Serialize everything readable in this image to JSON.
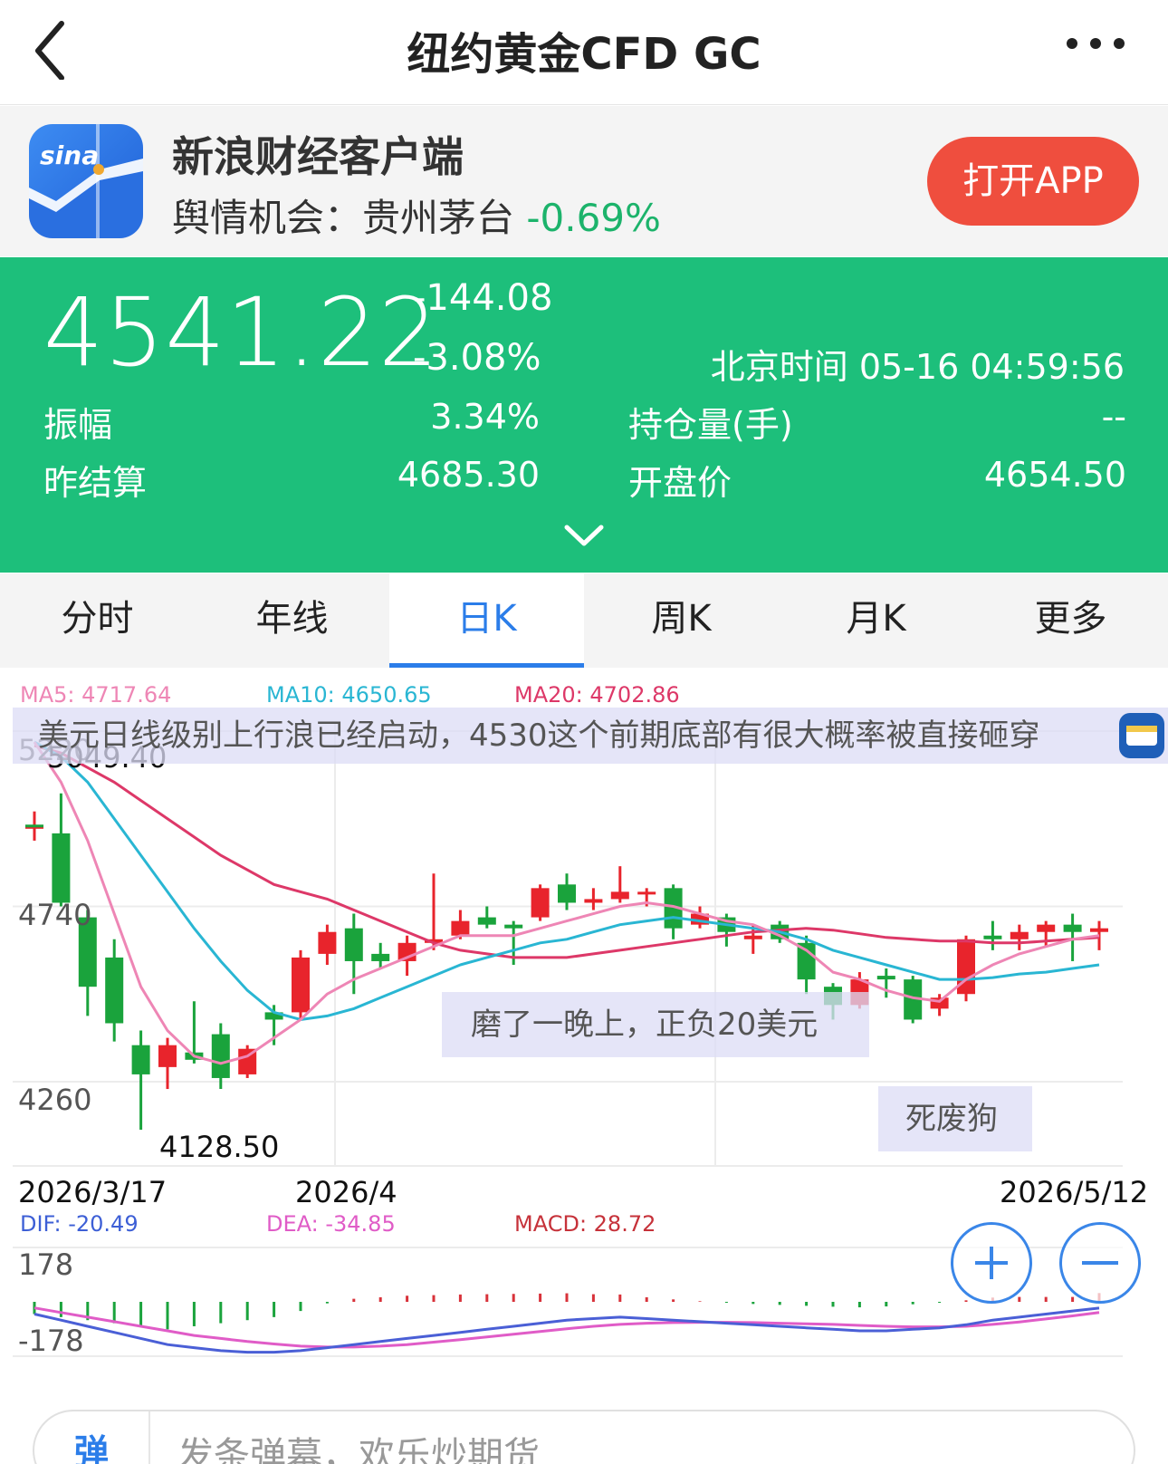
{
  "nav": {
    "title": "纽约黄金CFD GC"
  },
  "banner": {
    "app_name": "新浪财经客户端",
    "sub_prefix": "舆情机会：贵州茅台 ",
    "sub_pct": "-0.69%",
    "open_button": "打开APP",
    "logo_text": "sina",
    "color_button": "#ef4e3e"
  },
  "quote": {
    "price": "4541.22",
    "change": "-144.08",
    "change_pct": "-3.08%",
    "time": "北京时间 05-16 04:59:56",
    "amplitude_label": "振幅",
    "amplitude_value": "3.34%",
    "open_interest_label": "持仓量(手)",
    "open_interest_value": "--",
    "prev_settle_label": "昨结算",
    "prev_settle_value": "4685.30",
    "open_label": "开盘价",
    "open_value": "4654.50",
    "color_panel": "#1dbf7b"
  },
  "tabs": [
    {
      "label": "分时",
      "active": false
    },
    {
      "label": "年线",
      "active": false
    },
    {
      "label": "日K",
      "active": true
    },
    {
      "label": "周K",
      "active": false
    },
    {
      "label": "月K",
      "active": false
    },
    {
      "label": "更多",
      "active": false
    }
  ],
  "chart": {
    "ma5": "MA5: 4717.64",
    "ma10": "MA10: 4650.65",
    "ma20": "MA20: 4702.86",
    "y_top": "5220",
    "y_mid": "4740",
    "y_bottom": "4260",
    "high_label": "5049.40",
    "low_label": "4128.50",
    "date_start": "2026/3/17",
    "date_mid": "2026/4",
    "date_end": "2026/5/12",
    "dif": "DIF: -20.49",
    "dea": "DEA: -34.85",
    "macd": "MACD: 28.72",
    "macd_top": "178",
    "macd_bottom": "-178"
  },
  "danmaku": {
    "d1": "美元日线级别上行浪已经启动，4530这个前期底部有很大概率被直接砸穿",
    "d2": "磨了一晚上，正负20美元",
    "d3": "死废狗"
  },
  "comment": {
    "icon": "弹",
    "placeholder": "发条弹幕，欢乐炒期货"
  },
  "chart_data": {
    "type": "candlestick",
    "title": "",
    "x": [
      "2026/3/17",
      "",
      "",
      "",
      "",
      "",
      "",
      "",
      "",
      "",
      "",
      "2026/4",
      "",
      "",
      "",
      "",
      "",
      "",
      "",
      "",
      "",
      "",
      "",
      "",
      "",
      "",
      "",
      "",
      "",
      "",
      "",
      "",
      "",
      "",
      "",
      "",
      "",
      "",
      "",
      "",
      "2026/5/12"
    ],
    "ylim": [
      4128.5,
      5220
    ],
    "y_ticks": [
      5220,
      4740,
      4260
    ],
    "colors": {
      "up": "#e8242c",
      "down": "#1aa33c",
      "ma5": "#ee86b5",
      "ma10": "#29b6d3",
      "ma20": "#dd3868"
    },
    "candles": [
      {
        "o": 4960,
        "c": 4960,
        "h": 5000,
        "l": 4920
      },
      {
        "o": 4940,
        "c": 4750,
        "h": 5049.4,
        "l": 4740
      },
      {
        "o": 4710,
        "c": 4520,
        "h": 4730,
        "l": 4440
      },
      {
        "o": 4600,
        "c": 4420,
        "h": 4650,
        "l": 4370
      },
      {
        "o": 4360,
        "c": 4280,
        "h": 4400,
        "l": 4128.5
      },
      {
        "o": 4300,
        "c": 4360,
        "h": 4380,
        "l": 4240
      },
      {
        "o": 4340,
        "c": 4320,
        "h": 4480,
        "l": 4310
      },
      {
        "o": 4390,
        "c": 4270,
        "h": 4420,
        "l": 4240
      },
      {
        "o": 4280,
        "c": 4350,
        "h": 4360,
        "l": 4270
      },
      {
        "o": 4450,
        "c": 4430,
        "h": 4470,
        "l": 4360
      },
      {
        "o": 4450,
        "c": 4600,
        "h": 4620,
        "l": 4430
      },
      {
        "o": 4610,
        "c": 4670,
        "h": 4690,
        "l": 4580
      },
      {
        "o": 4680,
        "c": 4590,
        "h": 4720,
        "l": 4500
      },
      {
        "o": 4610,
        "c": 4590,
        "h": 4640,
        "l": 4570
      },
      {
        "o": 4590,
        "c": 4640,
        "h": 4660,
        "l": 4550
      },
      {
        "o": 4640,
        "c": 4650,
        "h": 4830,
        "l": 4620
      },
      {
        "o": 4660,
        "c": 4700,
        "h": 4730,
        "l": 4650
      },
      {
        "o": 4710,
        "c": 4690,
        "h": 4740,
        "l": 4680
      },
      {
        "o": 4690,
        "c": 4680,
        "h": 4700,
        "l": 4580
      },
      {
        "o": 4710,
        "c": 4790,
        "h": 4800,
        "l": 4700
      },
      {
        "o": 4800,
        "c": 4750,
        "h": 4830,
        "l": 4730
      },
      {
        "o": 4750,
        "c": 4760,
        "h": 4790,
        "l": 4730
      },
      {
        "o": 4760,
        "c": 4780,
        "h": 4850,
        "l": 4750
      },
      {
        "o": 4780,
        "c": 4780,
        "h": 4790,
        "l": 4740
      },
      {
        "o": 4790,
        "c": 4680,
        "h": 4800,
        "l": 4650
      },
      {
        "o": 4690,
        "c": 4720,
        "h": 4740,
        "l": 4680
      },
      {
        "o": 4710,
        "c": 4670,
        "h": 4720,
        "l": 4630
      },
      {
        "o": 4650,
        "c": 4660,
        "h": 4690,
        "l": 4610
      },
      {
        "o": 4690,
        "c": 4650,
        "h": 4700,
        "l": 4640
      },
      {
        "o": 4640,
        "c": 4540,
        "h": 4660,
        "l": 4500
      },
      {
        "o": 4520,
        "c": 4470,
        "h": 4530,
        "l": 4430
      },
      {
        "o": 4470,
        "c": 4540,
        "h": 4560,
        "l": 4460
      },
      {
        "o": 4550,
        "c": 4540,
        "h": 4570,
        "l": 4490
      },
      {
        "o": 4540,
        "c": 4430,
        "h": 4550,
        "l": 4420
      },
      {
        "o": 4460,
        "c": 4490,
        "h": 4500,
        "l": 4440
      },
      {
        "o": 4500,
        "c": 4650,
        "h": 4660,
        "l": 4480
      },
      {
        "o": 4660,
        "c": 4650,
        "h": 4700,
        "l": 4620
      },
      {
        "o": 4650,
        "c": 4670,
        "h": 4690,
        "l": 4620
      },
      {
        "o": 4670,
        "c": 4690,
        "h": 4700,
        "l": 4630
      },
      {
        "o": 4690,
        "c": 4670,
        "h": 4720,
        "l": 4590
      },
      {
        "o": 4670,
        "c": 4680,
        "h": 4700,
        "l": 4620
      }
    ],
    "ma5": [
      5190,
      5080,
      4920,
      4720,
      4520,
      4400,
      4330,
      4310,
      4330,
      4380,
      4430,
      4500,
      4540,
      4570,
      4600,
      4630,
      4660,
      4660,
      4660,
      4680,
      4700,
      4720,
      4740,
      4750,
      4740,
      4720,
      4700,
      4690,
      4660,
      4620,
      4560,
      4540,
      4510,
      4490,
      4480,
      4540,
      4580,
      4610,
      4630,
      4650,
      4660
    ],
    "ma10": [
      5190,
      5150,
      5080,
      4980,
      4880,
      4780,
      4680,
      4590,
      4510,
      4450,
      4430,
      4440,
      4460,
      4490,
      4520,
      4550,
      4580,
      4600,
      4620,
      4640,
      4650,
      4670,
      4690,
      4700,
      4710,
      4700,
      4690,
      4680,
      4670,
      4650,
      4620,
      4600,
      4580,
      4560,
      4540,
      4540,
      4545,
      4555,
      4560,
      4570,
      4580
    ],
    "ma20": [
      5180,
      5160,
      5120,
      5080,
      5030,
      4980,
      4930,
      4880,
      4840,
      4800,
      4780,
      4760,
      4730,
      4700,
      4670,
      4640,
      4620,
      4610,
      4600,
      4600,
      4600,
      4610,
      4620,
      4630,
      4640,
      4650,
      4660,
      4670,
      4675,
      4680,
      4675,
      4665,
      4655,
      4650,
      4645,
      4645,
      4640,
      4640,
      4645,
      4650,
      4655
    ],
    "macd": {
      "ylim": [
        -178,
        178
      ],
      "dif": [
        -40,
        -60,
        -80,
        -100,
        -120,
        -140,
        -150,
        -160,
        -165,
        -165,
        -160,
        -150,
        -140,
        -130,
        -120,
        -110,
        -100,
        -90,
        -80,
        -70,
        -60,
        -55,
        -50,
        -55,
        -60,
        -65,
        -70,
        -75,
        -80,
        -85,
        -90,
        -95,
        -95,
        -90,
        -85,
        -75,
        -60,
        -50,
        -40,
        -30,
        -20.49
      ],
      "dea": [
        -20,
        -35,
        -50,
        -65,
        -80,
        -95,
        -110,
        -120,
        -130,
        -138,
        -145,
        -148,
        -148,
        -145,
        -140,
        -132,
        -124,
        -115,
        -106,
        -97,
        -88,
        -80,
        -74,
        -70,
        -68,
        -67,
        -67,
        -68,
        -70,
        -72,
        -74,
        -77,
        -80,
        -82,
        -82,
        -80,
        -74,
        -66,
        -56,
        -46,
        -34.85
      ],
      "hist": [
        -40,
        -50,
        -60,
        -70,
        -80,
        -90,
        -80,
        -70,
        -60,
        -50,
        -30,
        -5,
        10,
        15,
        20,
        22,
        24,
        25,
        26,
        27,
        28,
        25,
        24,
        15,
        8,
        2,
        -3,
        -7,
        -10,
        -13,
        -16,
        -18,
        -15,
        -8,
        -3,
        5,
        14,
        16,
        16,
        16,
        28.72
      ]
    }
  }
}
